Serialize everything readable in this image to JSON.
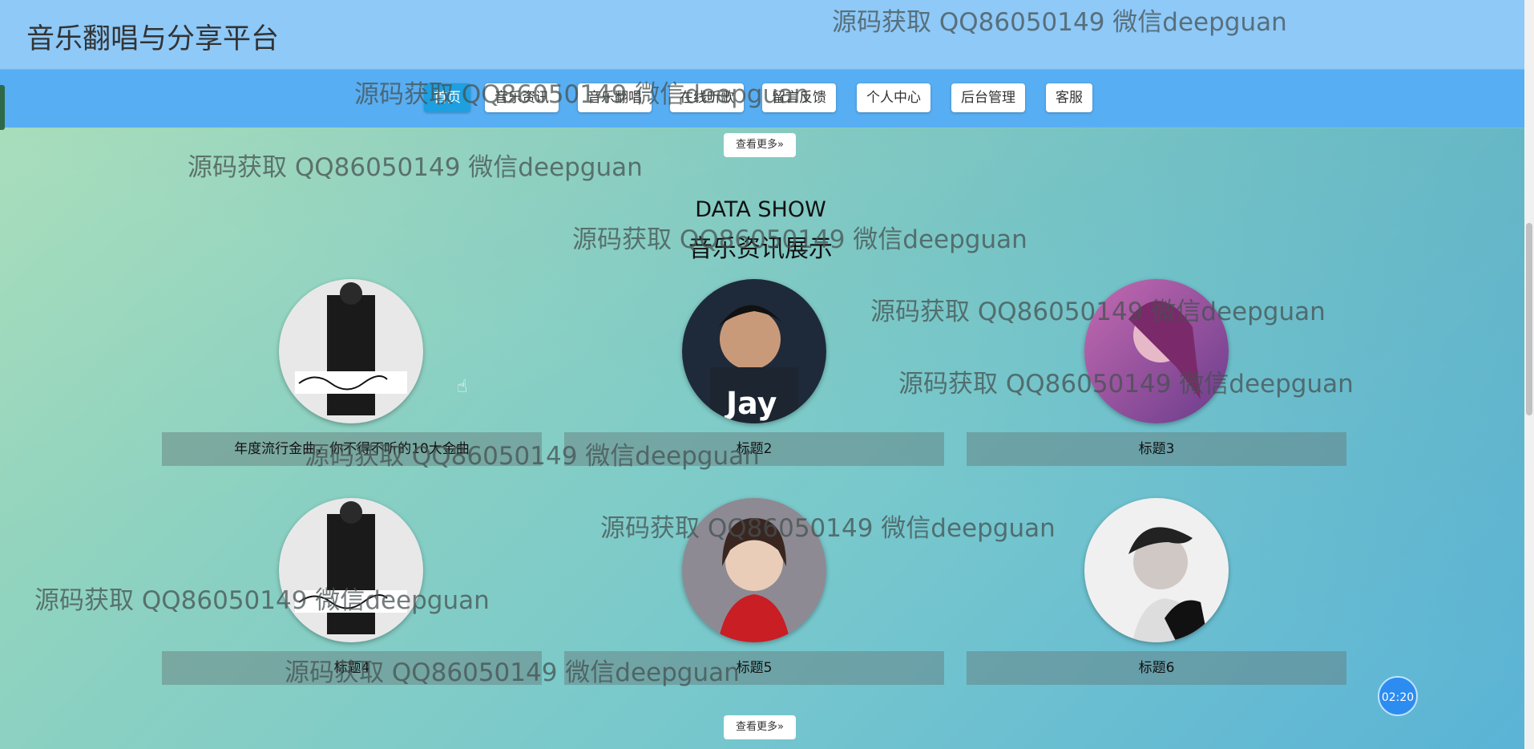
{
  "header": {
    "title": "音乐翻唱与分享平台"
  },
  "nav": {
    "items": [
      {
        "label": "首页"
      },
      {
        "label": "音乐资讯"
      },
      {
        "label": "音乐翻唱"
      },
      {
        "label": "在线听歌"
      },
      {
        "label": "留言反馈"
      },
      {
        "label": "个人中心"
      },
      {
        "label": "后台管理"
      },
      {
        "label": "客服"
      }
    ]
  },
  "more_label": "查看更多»",
  "section": {
    "title_en": "DATA SHOW",
    "title_cn": "音乐资讯展示"
  },
  "cards": [
    {
      "title": "年度流行金曲，你不得不听的10大金曲"
    },
    {
      "title": "标题2"
    },
    {
      "title": "标题3"
    },
    {
      "title": "标题4"
    },
    {
      "title": "标题5"
    },
    {
      "title": "标题6"
    }
  ],
  "watermark": "源码获取 QQ86050149 微信deepguan",
  "timer": "02:20",
  "colors": {
    "header_bg": "#8ec9f8",
    "nav_bg": "#58aef3",
    "active_btn": "#1e9fe0"
  }
}
